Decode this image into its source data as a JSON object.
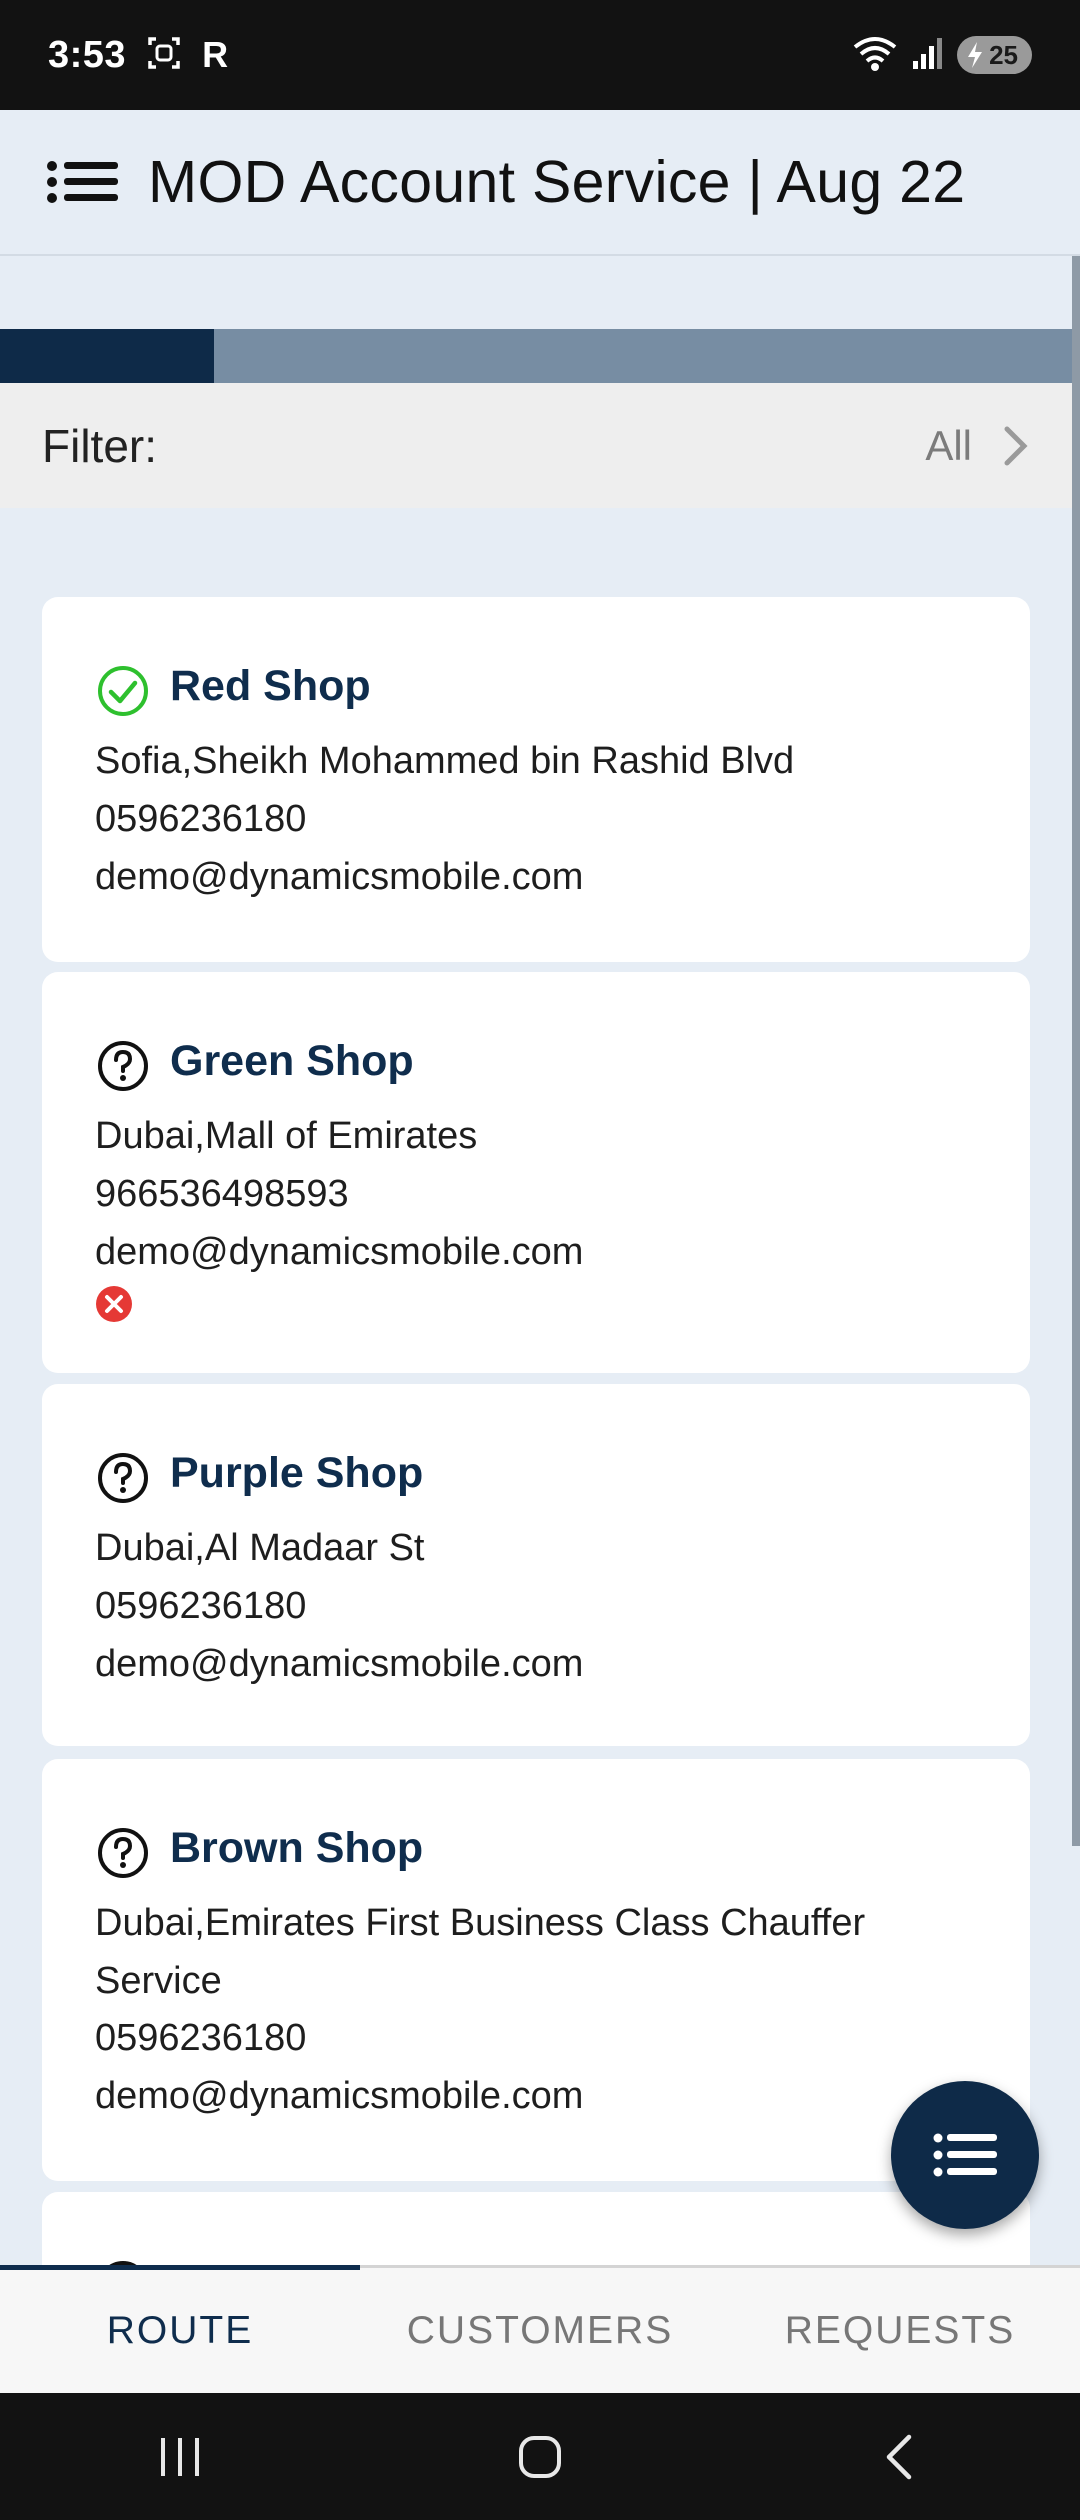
{
  "status_bar": {
    "time": "3:53",
    "letter": "R",
    "battery_level": "25"
  },
  "app_bar": {
    "title": "MOD Account Service | Aug 22"
  },
  "progress": {
    "value_fraction": 0.2
  },
  "filter": {
    "label": "Filter:",
    "value": "All"
  },
  "customers": [
    {
      "name": "Red Shop",
      "address": "Sofia,Sheikh Mohammed bin Rashid Blvd",
      "phone": "0596236180",
      "email": "demo@dynamicsmobile.com",
      "status": "check-circle-icon"
    },
    {
      "name": "Green Shop",
      "address": "Dubai,Mall of Emirates",
      "phone": "966536498593",
      "email": "demo@dynamicsmobile.com",
      "status": "question-circle-icon",
      "error": "error-icon"
    },
    {
      "name": "Purple Shop",
      "address": "Dubai,Al Madaar St",
      "phone": "0596236180",
      "email": "demo@dynamicsmobile.com",
      "status": "question-circle-icon"
    },
    {
      "name": "Brown Shop",
      "address_line1": "Dubai,Emirates First Business Class Chauffer",
      "address_line2": "Service",
      "phone": "0596236180",
      "email": "demo@dynamicsmobile.com",
      "status": "question-circle-icon"
    }
  ],
  "bottom_nav": {
    "tabs": [
      "ROUTE",
      "CUSTOMERS",
      "REQUESTS"
    ],
    "active": "ROUTE"
  },
  "colors": {
    "accent": "#0e2a48",
    "progress_track": "#778da3",
    "success": "#2ec02e",
    "error": "#e53935",
    "background": "#e6edf5"
  }
}
